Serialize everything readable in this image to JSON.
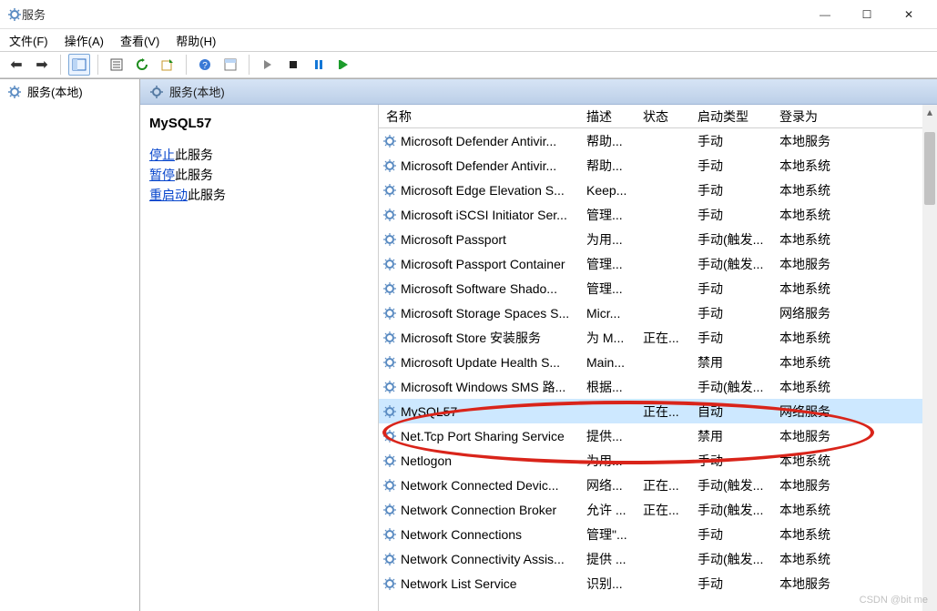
{
  "window": {
    "title": "服务",
    "watermark": "CSDN @bit me"
  },
  "menu": {
    "file": "文件(F)",
    "action": "操作(A)",
    "view": "查看(V)",
    "help": "帮助(H)"
  },
  "tree": {
    "root": "服务(本地)"
  },
  "header": {
    "label": "服务(本地)"
  },
  "detail": {
    "service_name": "MySQL57",
    "stop_link": "停止",
    "stop_suffix": "此服务",
    "pause_link": "暂停",
    "pause_suffix": "此服务",
    "restart_link": "重启动",
    "restart_suffix": "此服务"
  },
  "columns": {
    "name": "名称",
    "description": "描述",
    "status": "状态",
    "startup": "启动类型",
    "logon": "登录为"
  },
  "rows": [
    {
      "name": "Microsoft Defender Antivir...",
      "desc": "帮助...",
      "status": "",
      "startup": "手动",
      "logon": "本地服务"
    },
    {
      "name": "Microsoft Defender Antivir...",
      "desc": "帮助...",
      "status": "",
      "startup": "手动",
      "logon": "本地系统"
    },
    {
      "name": "Microsoft Edge Elevation S...",
      "desc": "Keep...",
      "status": "",
      "startup": "手动",
      "logon": "本地系统"
    },
    {
      "name": "Microsoft iSCSI Initiator Ser...",
      "desc": "管理...",
      "status": "",
      "startup": "手动",
      "logon": "本地系统"
    },
    {
      "name": "Microsoft Passport",
      "desc": "为用...",
      "status": "",
      "startup": "手动(触发...",
      "logon": "本地系统"
    },
    {
      "name": "Microsoft Passport Container",
      "desc": "管理...",
      "status": "",
      "startup": "手动(触发...",
      "logon": "本地服务"
    },
    {
      "name": "Microsoft Software Shado...",
      "desc": "管理...",
      "status": "",
      "startup": "手动",
      "logon": "本地系统"
    },
    {
      "name": "Microsoft Storage Spaces S...",
      "desc": "Micr...",
      "status": "",
      "startup": "手动",
      "logon": "网络服务"
    },
    {
      "name": "Microsoft Store 安装服务",
      "desc": "为 M...",
      "status": "正在...",
      "startup": "手动",
      "logon": "本地系统"
    },
    {
      "name": "Microsoft Update Health S...",
      "desc": "Main...",
      "status": "",
      "startup": "禁用",
      "logon": "本地系统"
    },
    {
      "name": "Microsoft Windows SMS 路...",
      "desc": "根据...",
      "status": "",
      "startup": "手动(触发...",
      "logon": "本地系统"
    },
    {
      "name": "MySQL57",
      "desc": "",
      "status": "正在...",
      "startup": "自动",
      "logon": "网络服务",
      "selected": true
    },
    {
      "name": "Net.Tcp Port Sharing Service",
      "desc": "提供...",
      "status": "",
      "startup": "禁用",
      "logon": "本地服务"
    },
    {
      "name": "Netlogon",
      "desc": "为用...",
      "status": "",
      "startup": "手动",
      "logon": "本地系统"
    },
    {
      "name": "Network Connected Devic...",
      "desc": "网络...",
      "status": "正在...",
      "startup": "手动(触发...",
      "logon": "本地服务"
    },
    {
      "name": "Network Connection Broker",
      "desc": "允许 ...",
      "status": "正在...",
      "startup": "手动(触发...",
      "logon": "本地系统"
    },
    {
      "name": "Network Connections",
      "desc": "管理\"...",
      "status": "",
      "startup": "手动",
      "logon": "本地系统"
    },
    {
      "name": "Network Connectivity Assis...",
      "desc": "提供 ...",
      "status": "",
      "startup": "手动(触发...",
      "logon": "本地系统"
    },
    {
      "name": "Network List Service",
      "desc": "识别...",
      "status": "",
      "startup": "手动",
      "logon": "本地服务"
    }
  ]
}
